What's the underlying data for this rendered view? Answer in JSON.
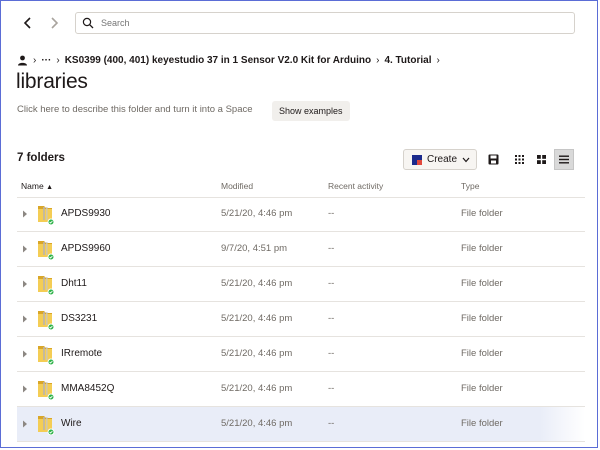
{
  "nav": {
    "back": "back-arrow-icon",
    "forward": "forward-arrow-icon"
  },
  "search": {
    "placeholder": "Search"
  },
  "breadcrumb": {
    "ellipsis": "···",
    "items": [
      "KS0399 (400, 401) keyestudio 37 in 1 Sensor V2.0 Kit for Arduino",
      "4. Tutorial"
    ]
  },
  "title": "libraries",
  "description": "Click here to describe this folder and turn it into a Space",
  "show_examples": "Show examples",
  "folder_count": "7 folders",
  "toolbar": {
    "create": "Create"
  },
  "table": {
    "headers": {
      "name": "Name",
      "modified": "Modified",
      "activity": "Recent activity",
      "type": "Type"
    },
    "rows": [
      {
        "name": "APDS9930",
        "modified": "5/21/20, 4:46 pm",
        "activity": "--",
        "type": "File folder"
      },
      {
        "name": "APDS9960",
        "modified": "9/7/20, 4:51 pm",
        "activity": "--",
        "type": "File folder"
      },
      {
        "name": "Dht11",
        "modified": "5/21/20, 4:46 pm",
        "activity": "--",
        "type": "File folder"
      },
      {
        "name": "DS3231",
        "modified": "5/21/20, 4:46 pm",
        "activity": "--",
        "type": "File folder"
      },
      {
        "name": "IRremote",
        "modified": "5/21/20, 4:46 pm",
        "activity": "--",
        "type": "File folder"
      },
      {
        "name": "MMA8452Q",
        "modified": "5/21/20, 4:46 pm",
        "activity": "--",
        "type": "File folder"
      },
      {
        "name": "Wire",
        "modified": "5/21/20, 4:46 pm",
        "activity": "--",
        "type": "File folder"
      }
    ]
  },
  "colors": {
    "accent": "#0061fe",
    "selected_row": "#e9edf8",
    "sync_badge": "#2fb34a"
  }
}
